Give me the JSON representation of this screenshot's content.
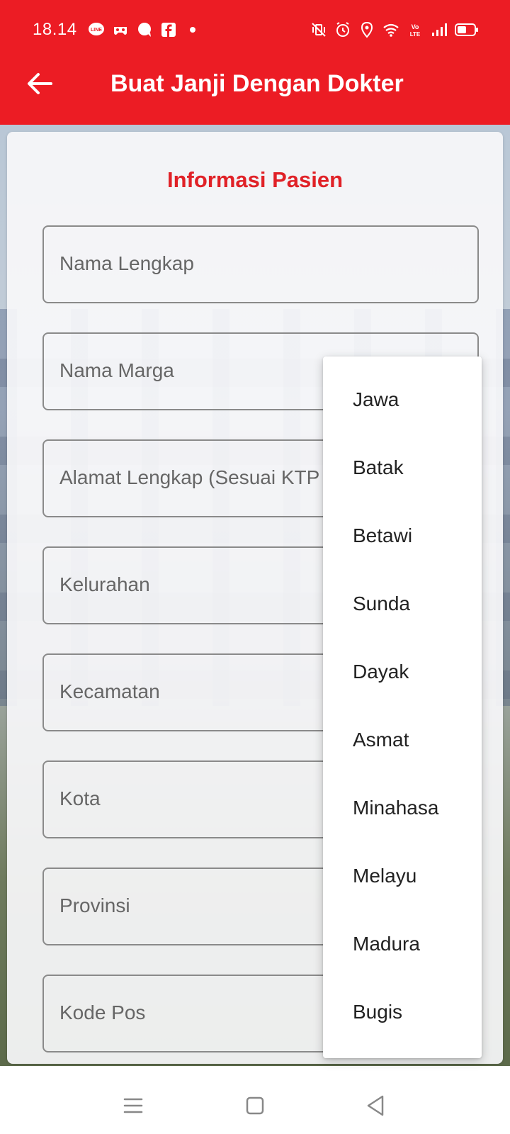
{
  "status_bar": {
    "time": "18.14",
    "left_icons": [
      "line-icon",
      "game-icon",
      "chat-icon",
      "facebook-icon",
      "dot-icon"
    ],
    "right_icons": [
      "mute-vibrate-icon",
      "alarm-icon",
      "location-icon",
      "wifi-icon",
      "volte-icon",
      "signal-icon",
      "battery-icon"
    ]
  },
  "app_bar": {
    "title": "Buat Janji Dengan Dokter",
    "background": "#ec1c24"
  },
  "form": {
    "section_title": "Informasi Pasien",
    "fields": [
      "Nama Lengkap",
      "Nama Marga",
      "Alamat Lengkap (Sesuai KTP",
      "Kelurahan",
      "Kecamatan",
      "Kota",
      "Provinsi",
      "Kode Pos"
    ]
  },
  "dropdown": {
    "options": [
      "Jawa",
      "Batak",
      "Betawi",
      "Sunda",
      "Dayak",
      "Asmat",
      "Minahasa",
      "Melayu",
      "Madura",
      "Bugis"
    ]
  },
  "nav_bar": {
    "buttons": [
      "menu-icon",
      "home-icon",
      "back-icon"
    ]
  }
}
